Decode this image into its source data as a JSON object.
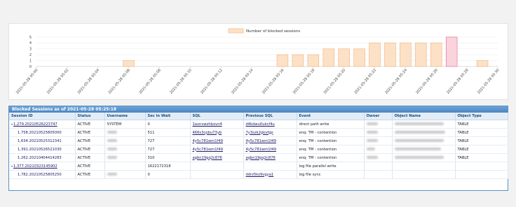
{
  "chart_data": {
    "type": "bar",
    "legend": "Number of blocked sessions",
    "legend_position": "top",
    "categories": [
      "05:00",
      "05:01",
      "05:02",
      "05:03",
      "05:04",
      "05:05",
      "05:06",
      "05:07",
      "05:08",
      "05:09",
      "05:10",
      "05:11",
      "05:12",
      "05:13",
      "05:14",
      "05:15",
      "05:16",
      "05:17",
      "05:18",
      "05:19",
      "05:20",
      "05:21",
      "05:22",
      "05:23",
      "05:24",
      "05:25",
      "05:26",
      "05:27",
      "05:28",
      "05:29",
      "05:30"
    ],
    "x_tick_labels": [
      "2021-05-28 05:00",
      "2021-05-28 05:02",
      "2021-05-28 05:04",
      "2021-05-28 05:06",
      "2021-05-28 05:08",
      "2021-05-28 05:10",
      "2021-05-28 05:12",
      "2021-05-28 05:14",
      "2021-05-28 05:16",
      "2021-05-28 05:18",
      "2021-05-28 05:20",
      "2021-05-28 05:22",
      "2021-05-28 05:24",
      "2021-05-28 05:26",
      "2021-05-28 05:28",
      "2021-05-28 05:30"
    ],
    "values": [
      0,
      0,
      0,
      0,
      0,
      0,
      1,
      0,
      0,
      0,
      0,
      0,
      0,
      0,
      0,
      0,
      2,
      2,
      2,
      3,
      3,
      3,
      4,
      4,
      4,
      4,
      4,
      5,
      0,
      1,
      0
    ],
    "highlight_index": 27,
    "ylim": [
      0,
      5
    ],
    "yticks": [
      0,
      1,
      2,
      3,
      4,
      5
    ],
    "grid": true,
    "colors": {
      "bar_fill": "#fde1c6",
      "bar_stroke": "#f0b98a",
      "highlight_fill": "#fbd3dc",
      "highlight_stroke": "#e07a93"
    }
  },
  "panel": {
    "title": "Blocked Sessions as of 2021-05-28 05:25:18"
  },
  "table": {
    "headers": [
      "Session ID",
      "Status",
      "Username",
      "Sec in Wait",
      "SQL",
      "Previous SQL",
      "Event",
      "Owner",
      "Object Name",
      "Object Type"
    ],
    "rows": [
      {
        "session_id": "1,279.20210526223747",
        "status": "ACTIVE",
        "username": "SYSTEM",
        "sec_in_wait": "0",
        "sql": "1avnvwzhbxvn4",
        "prev_sql": "d4kdwu0ukcf4u",
        "event": "direct path write",
        "object_type": "TABLE",
        "toggle": "▾"
      },
      {
        "session_id": "1,758.20210525805000",
        "status": "ACTIVE",
        "username": "",
        "sec_in_wait": "511",
        "sql": "466s3cpbu73yb",
        "prev_sql": "7y3szk2gkvfgp",
        "event": "enq: TM - contention",
        "object_type": "TABLE",
        "toggle": ""
      },
      {
        "session_id": "1,634.20210525312341",
        "status": "ACTIVE",
        "username": "",
        "sec_in_wait": "727",
        "sql": "4y5c781wm1f49",
        "prev_sql": "4y5c781wm1f49",
        "event": "enq: TM - contention",
        "object_type": "TABLE",
        "toggle": ""
      },
      {
        "session_id": "1,391.20210526521030",
        "status": "ACTIVE",
        "username": "",
        "sec_in_wait": "727",
        "sql": "4y5c781wm1f49",
        "prev_sql": "4y5c781wm1f49",
        "event": "enq: TM - contention",
        "object_type": "TABLE",
        "toggle": ""
      },
      {
        "session_id": "1,262.20210404414283",
        "status": "ACTIVE",
        "username": "",
        "sec_in_wait": "310",
        "sql": "agbn19gq2c876",
        "prev_sql": "agbn19gq2c876",
        "event": "enq: TM - contention",
        "object_type": "TABLE",
        "toggle": ""
      },
      {
        "session_id": "1,377.20210323145902",
        "status": "ACTIVE",
        "username": "",
        "sec_in_wait": "1622172318",
        "sql": "",
        "prev_sql": "",
        "event": "log file parallel write",
        "object_type": "",
        "toggle": "▾"
      },
      {
        "session_id": "1,782.20210525805250",
        "status": "ACTIVE",
        "username": "",
        "sec_in_wait": "0",
        "sql": "",
        "prev_sql": "ddrz5kz9vgya1",
        "event": "log file sync",
        "object_type": "",
        "toggle": ""
      }
    ],
    "blurred": {
      "username": [
        false,
        true,
        true,
        true,
        true,
        false,
        true
      ],
      "owner": [
        true,
        true,
        true,
        true,
        true,
        false,
        false
      ],
      "object_name": [
        true,
        true,
        true,
        true,
        true,
        false,
        false
      ]
    }
  }
}
